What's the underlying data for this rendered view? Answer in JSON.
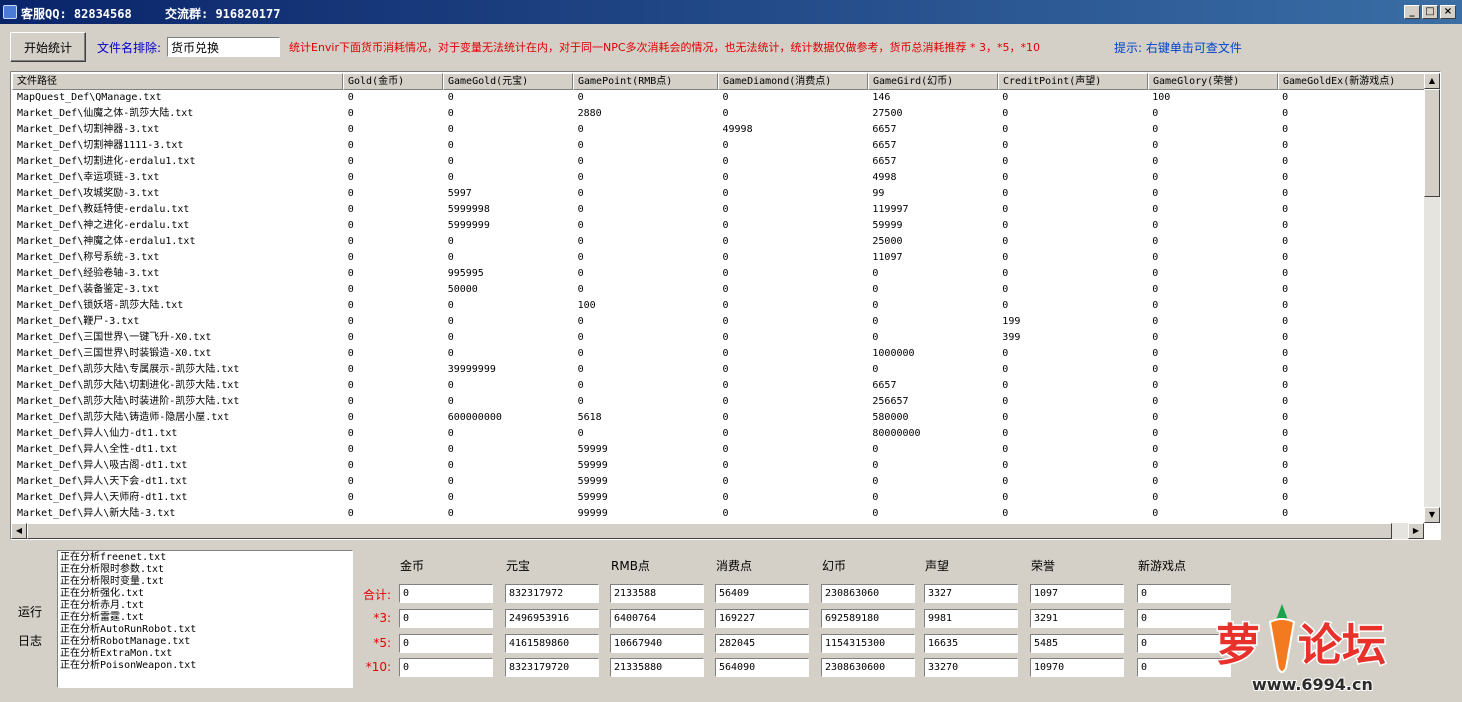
{
  "titlebar": {
    "support_qq": "客服QQ: 82834568",
    "group": "交流群: 916820177",
    "min": "_",
    "max": "□",
    "close": "×"
  },
  "toolbar": {
    "start_label": "开始统计",
    "exclude_label": "文件名排除:",
    "exclude_value": "货币兑换",
    "notice": "统计Envir下面货币消耗情况，对于变量无法统计在内，对于同一NPC多次消耗会的情况，也无法统计，统计数据仅做参考，货币总消耗推荐 * 3，*5，*10",
    "hint": "提示: 右键单击可查文件"
  },
  "table": {
    "columns": [
      "文件路径",
      "Gold(金币)",
      "GameGold(元宝)",
      "GamePoint(RMB点)",
      "GameDiamond(消费点)",
      "GameGird(幻币)",
      "CreditPoint(声望)",
      "GameGlory(荣誉)",
      "GameGoldEx(新游戏点)"
    ],
    "rows": [
      [
        "MapQuest_Def\\QManage.txt",
        "0",
        "0",
        "0",
        "0",
        "146",
        "0",
        "100",
        "0"
      ],
      [
        "Market_Def\\仙魔之体-凯莎大陆.txt",
        "0",
        "0",
        "2880",
        "0",
        "27500",
        "0",
        "0",
        "0"
      ],
      [
        "Market_Def\\切割神器-3.txt",
        "0",
        "0",
        "0",
        "49998",
        "6657",
        "0",
        "0",
        "0"
      ],
      [
        "Market_Def\\切割神器1111-3.txt",
        "0",
        "0",
        "0",
        "0",
        "6657",
        "0",
        "0",
        "0"
      ],
      [
        "Market_Def\\切割进化-erdalu1.txt",
        "0",
        "0",
        "0",
        "0",
        "6657",
        "0",
        "0",
        "0"
      ],
      [
        "Market_Def\\幸运项链-3.txt",
        "0",
        "0",
        "0",
        "0",
        "4998",
        "0",
        "0",
        "0"
      ],
      [
        "Market_Def\\攻城奖励-3.txt",
        "0",
        "5997",
        "0",
        "0",
        "99",
        "0",
        "0",
        "0"
      ],
      [
        "Market_Def\\教廷特使-erdalu.txt",
        "0",
        "5999998",
        "0",
        "0",
        "119997",
        "0",
        "0",
        "0"
      ],
      [
        "Market_Def\\神之进化-erdalu.txt",
        "0",
        "5999999",
        "0",
        "0",
        "59999",
        "0",
        "0",
        "0"
      ],
      [
        "Market_Def\\神魔之体-erdalu1.txt",
        "0",
        "0",
        "0",
        "0",
        "25000",
        "0",
        "0",
        "0"
      ],
      [
        "Market_Def\\称号系统-3.txt",
        "0",
        "0",
        "0",
        "0",
        "11097",
        "0",
        "0",
        "0"
      ],
      [
        "Market_Def\\经验卷轴-3.txt",
        "0",
        "995995",
        "0",
        "0",
        "0",
        "0",
        "0",
        "0"
      ],
      [
        "Market_Def\\装备鉴定-3.txt",
        "0",
        "50000",
        "0",
        "0",
        "0",
        "0",
        "0",
        "0"
      ],
      [
        "Market_Def\\锁妖塔-凯莎大陆.txt",
        "0",
        "0",
        "100",
        "0",
        "0",
        "0",
        "0",
        "0"
      ],
      [
        "Market_Def\\鞭尸-3.txt",
        "0",
        "0",
        "0",
        "0",
        "0",
        "199",
        "0",
        "0"
      ],
      [
        "Market_Def\\三国世界\\一键飞升-X0.txt",
        "0",
        "0",
        "0",
        "0",
        "0",
        "399",
        "0",
        "0"
      ],
      [
        "Market_Def\\三国世界\\时装锻造-X0.txt",
        "0",
        "0",
        "0",
        "0",
        "1000000",
        "0",
        "0",
        "0"
      ],
      [
        "Market_Def\\凯莎大陆\\专属展示-凯莎大陆.txt",
        "0",
        "39999999",
        "0",
        "0",
        "0",
        "0",
        "0",
        "0"
      ],
      [
        "Market_Def\\凯莎大陆\\切割进化-凯莎大陆.txt",
        "0",
        "0",
        "0",
        "0",
        "6657",
        "0",
        "0",
        "0"
      ],
      [
        "Market_Def\\凯莎大陆\\时装进阶-凯莎大陆.txt",
        "0",
        "0",
        "0",
        "0",
        "256657",
        "0",
        "0",
        "0"
      ],
      [
        "Market_Def\\凯莎大陆\\铸造师-隐居小屋.txt",
        "0",
        "600000000",
        "5618",
        "0",
        "580000",
        "0",
        "0",
        "0"
      ],
      [
        "Market_Def\\异人\\仙力-dt1.txt",
        "0",
        "0",
        "0",
        "0",
        "80000000",
        "0",
        "0",
        "0"
      ],
      [
        "Market_Def\\异人\\全性-dt1.txt",
        "0",
        "0",
        "59999",
        "0",
        "0",
        "0",
        "0",
        "0"
      ],
      [
        "Market_Def\\异人\\吸古阁-dt1.txt",
        "0",
        "0",
        "59999",
        "0",
        "0",
        "0",
        "0",
        "0"
      ],
      [
        "Market_Def\\异人\\天下会-dt1.txt",
        "0",
        "0",
        "59999",
        "0",
        "0",
        "0",
        "0",
        "0"
      ],
      [
        "Market_Def\\异人\\天师府-dt1.txt",
        "0",
        "0",
        "59999",
        "0",
        "0",
        "0",
        "0",
        "0"
      ],
      [
        "Market_Def\\异人\\新大陆-3.txt",
        "0",
        "0",
        "99999",
        "0",
        "0",
        "0",
        "0",
        "0"
      ]
    ]
  },
  "log": {
    "label_line1": "运行",
    "label_line2": "日志",
    "lines": [
      "正在分析freenet.txt",
      "正在分析限时参数.txt",
      "正在分析限时变量.txt",
      "正在分析强化.txt",
      "正在分析赤月.txt",
      "正在分析雷霆.txt",
      "正在分析AutoRunRobot.txt",
      "正在分析RobotManage.txt",
      "正在分析ExtraMon.txt",
      "正在分析PoisonWeapon.txt"
    ]
  },
  "totals": {
    "columns": [
      "金币",
      "元宝",
      "RMB点",
      "消费点",
      "幻币",
      "声望",
      "荣誉",
      "新游戏点"
    ],
    "rows": [
      {
        "label": "合计:",
        "values": [
          "0",
          "832317972",
          "2133588",
          "56409",
          "230863060",
          "3327",
          "1097",
          "0"
        ]
      },
      {
        "label": "*3:",
        "values": [
          "0",
          "2496953916",
          "6400764",
          "169227",
          "692589180",
          "9981",
          "3291",
          "0"
        ]
      },
      {
        "label": "*5:",
        "values": [
          "0",
          "4161589860",
          "10667940",
          "282045",
          "1154315300",
          "16635",
          "5485",
          "0"
        ]
      },
      {
        "label": "*10:",
        "values": [
          "0",
          "8323179720",
          "21335880",
          "564090",
          "2308630600",
          "33270",
          "10970",
          "0"
        ]
      }
    ]
  },
  "watermark": {
    "logo_text": "萝卜论坛",
    "url": "www.6994.cn",
    "logo_color": "#e8312a",
    "accent_color": "#1aa34a"
  },
  "colors": {
    "notice": "#e00000",
    "label_blue": "#0000c8",
    "hint_blue": "#0044cc",
    "title_bar": "#0a246a"
  }
}
